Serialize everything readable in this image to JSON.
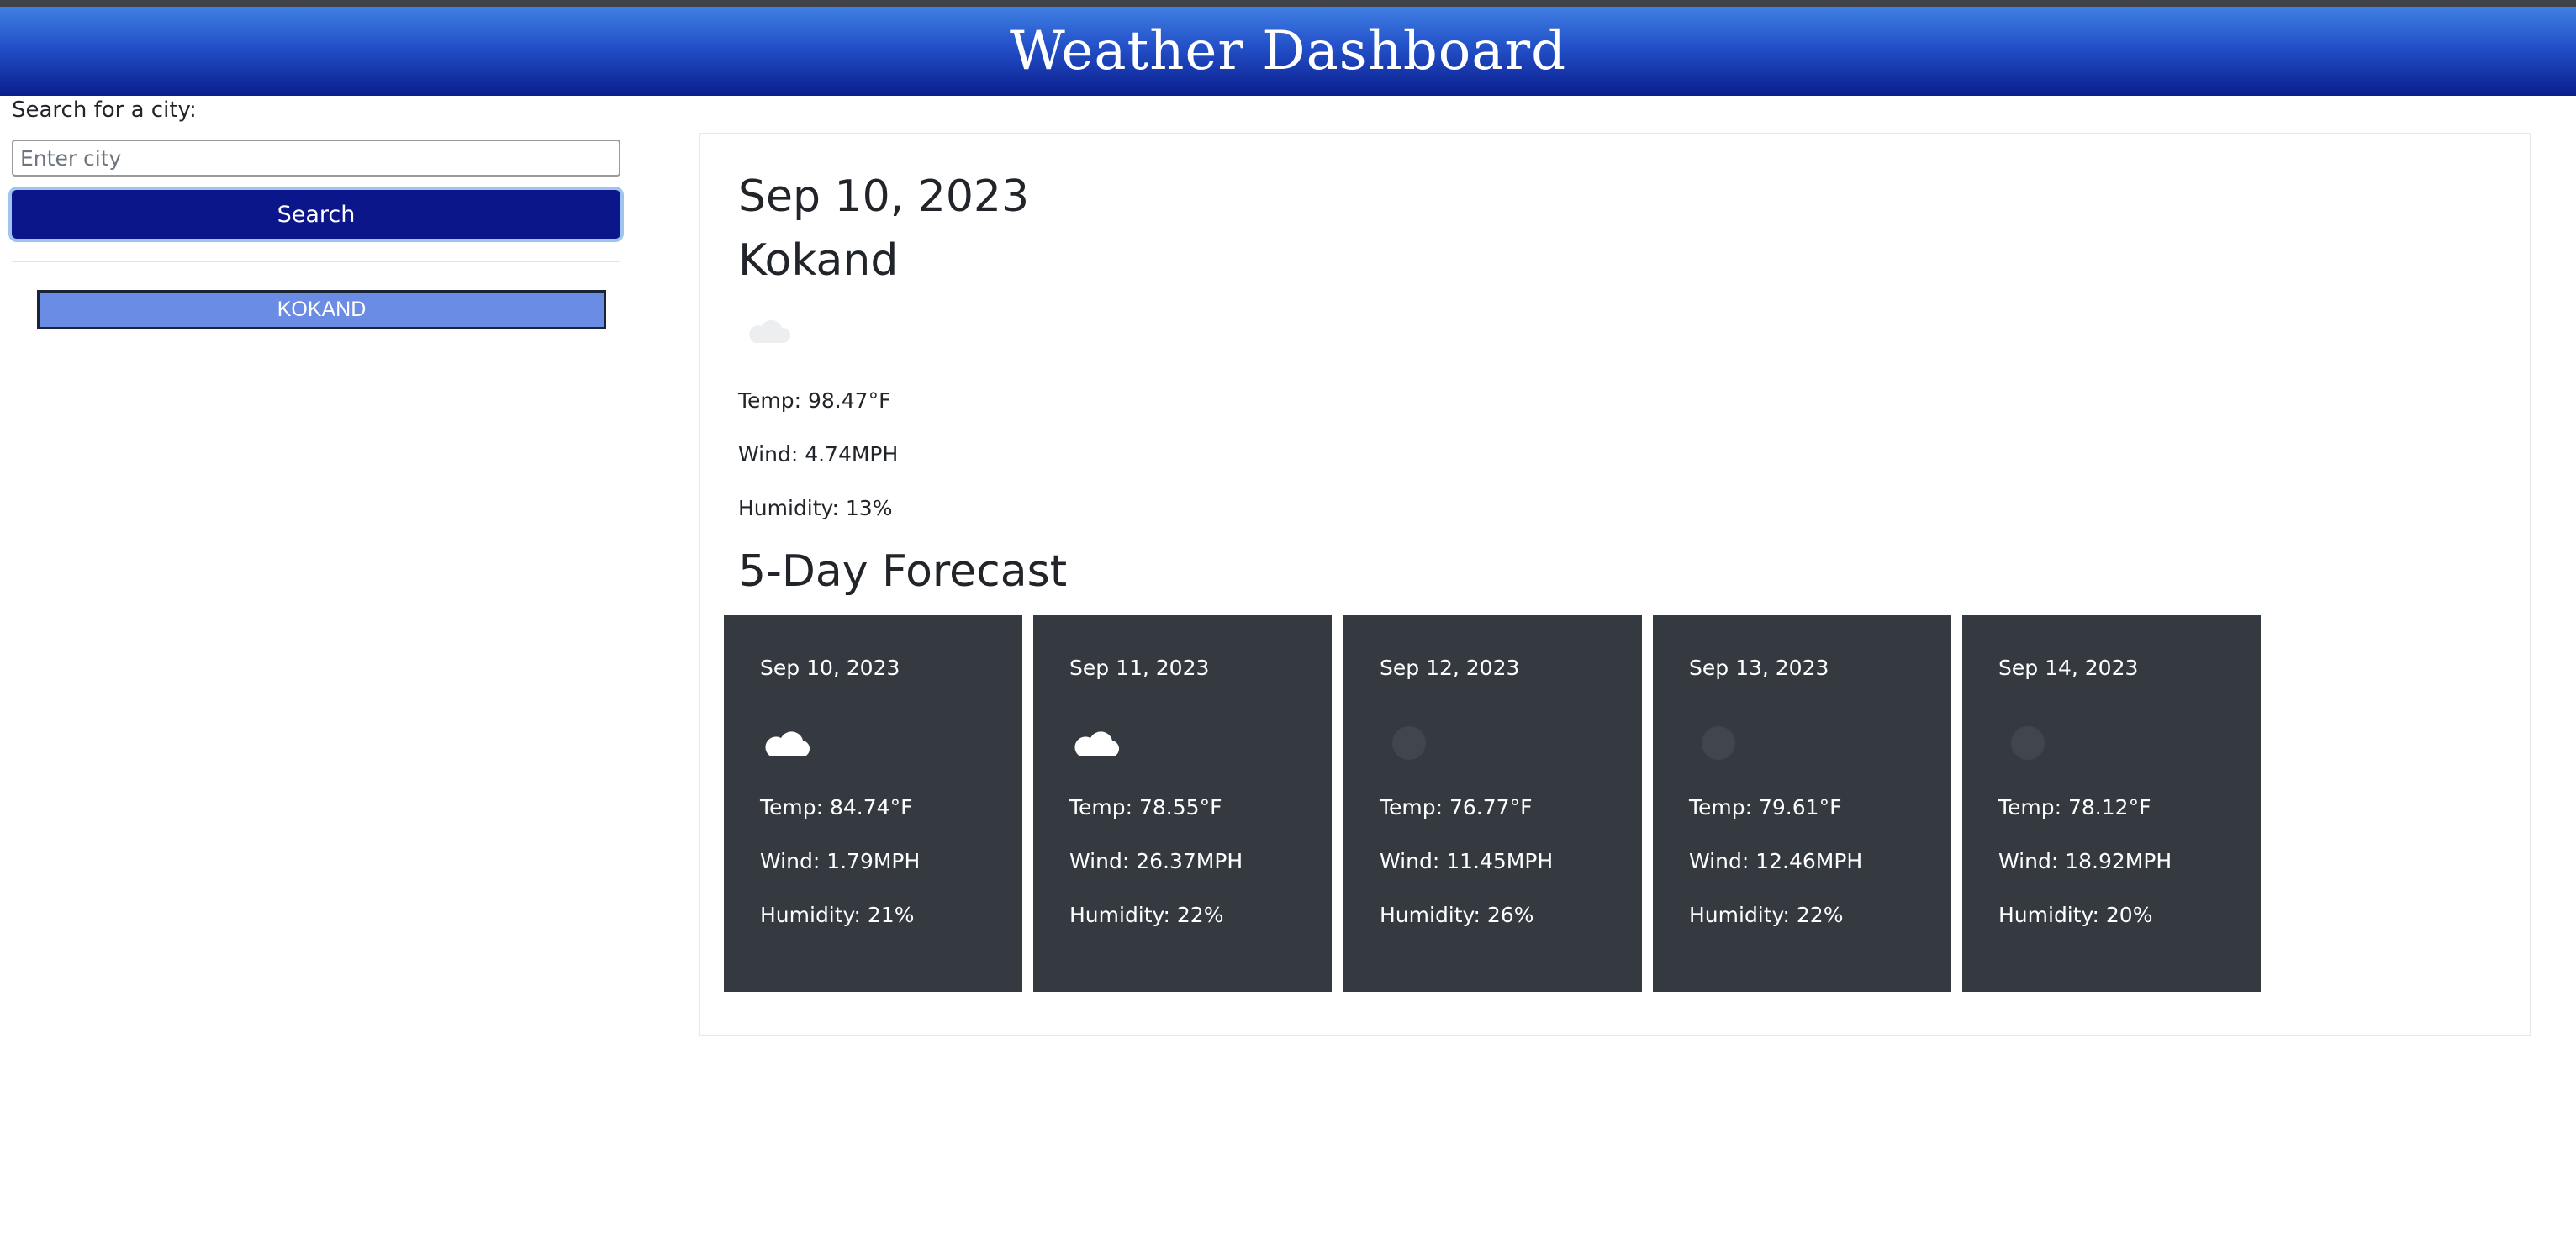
{
  "header": {
    "title": "Weather Dashboard"
  },
  "search": {
    "label": "Search for a city:",
    "placeholder": "Enter city",
    "value": "",
    "button_label": "Search"
  },
  "history": [
    "KOKAND"
  ],
  "current": {
    "date": "Sep 10, 2023",
    "city": "Kokand",
    "icon": "cloud-icon",
    "temp": "Temp: 98.47°F",
    "wind": "Wind: 4.74MPH",
    "humidity": "Humidity: 13%"
  },
  "forecast": {
    "title": "5-Day Forecast",
    "days": [
      {
        "date": "Sep 10, 2023",
        "icon": "cloud-icon",
        "temp": "Temp: 84.74°F",
        "wind": "Wind: 1.79MPH",
        "humidity": "Humidity: 21%"
      },
      {
        "date": "Sep 11, 2023",
        "icon": "cloud-icon",
        "temp": "Temp: 78.55°F",
        "wind": "Wind: 26.37MPH",
        "humidity": "Humidity: 22%"
      },
      {
        "date": "Sep 12, 2023",
        "icon": "clear-icon",
        "temp": "Temp: 76.77°F",
        "wind": "Wind: 11.45MPH",
        "humidity": "Humidity: 26%"
      },
      {
        "date": "Sep 13, 2023",
        "icon": "clear-icon",
        "temp": "Temp: 79.61°F",
        "wind": "Wind: 12.46MPH",
        "humidity": "Humidity: 22%"
      },
      {
        "date": "Sep 14, 2023",
        "icon": "clear-icon",
        "temp": "Temp: 78.12°F",
        "wind": "Wind: 18.92MPH",
        "humidity": "Humidity: 20%"
      }
    ]
  },
  "colors": {
    "header_top": "#3f7fe3",
    "header_bottom": "#0a1e8e",
    "search_button": "#0a168a",
    "history_button": "#6b8ce4",
    "forecast_card": "#343a40"
  }
}
